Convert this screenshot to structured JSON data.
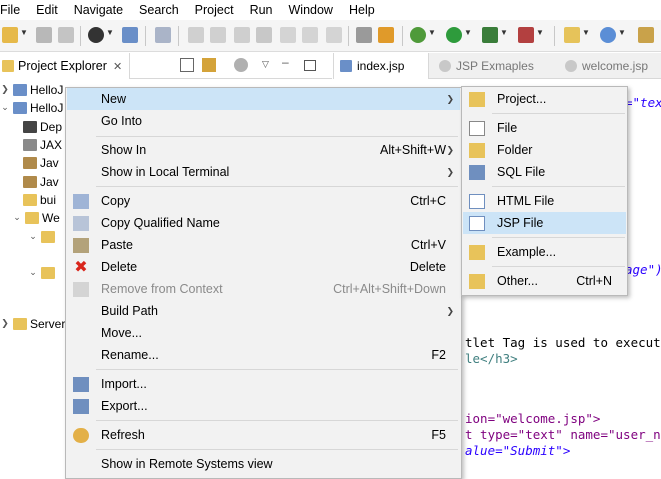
{
  "menubar": {
    "items": [
      "File",
      "Edit",
      "Navigate",
      "Search",
      "Project",
      "Run",
      "Window",
      "Help"
    ]
  },
  "project_explorer": {
    "tab_label": "Project Explorer",
    "close_glyph": "✕",
    "tree": [
      {
        "label": "HelloJ",
        "expanded": false
      },
      {
        "label": "HelloJ",
        "expanded": true
      },
      {
        "label": "Dep"
      },
      {
        "label": "JAX"
      },
      {
        "label": "Jav"
      },
      {
        "label": "Jav"
      },
      {
        "label": "bui"
      },
      {
        "label": "We"
      },
      {
        "label": "Server"
      }
    ]
  },
  "editor": {
    "tabs": [
      {
        "label": "index.jsp",
        "active": true
      },
      {
        "label": "JSP Exmaples",
        "active": false
      },
      {
        "label": "welcome.jsp",
        "active": false
      }
    ],
    "code_fragments": {
      "line_top_attr": "=\"tex",
      "line_age": "age\")",
      "line_scriptlet": "tlet Tag is used to execute",
      "line_h3": "le</h3>",
      "line_action": "ion=\"welcome.jsp\">",
      "line_input": "t type=\"text\" name=\"user_nam",
      "line_value": "alue=\"Submit\">"
    }
  },
  "context_menu": {
    "items": [
      {
        "label": "New",
        "shortcut": "",
        "submenu": true,
        "highlight": true
      },
      {
        "label": "Go Into",
        "shortcut": ""
      },
      {
        "label": "Show In",
        "shortcut": "Alt+Shift+W",
        "submenu": true
      },
      {
        "label": "Show in Local Terminal",
        "shortcut": "",
        "submenu": true
      },
      {
        "label": "Copy",
        "shortcut": "Ctrl+C"
      },
      {
        "label": "Copy Qualified Name",
        "shortcut": ""
      },
      {
        "label": "Paste",
        "shortcut": "Ctrl+V"
      },
      {
        "label": "Delete",
        "shortcut": "Delete"
      },
      {
        "label": "Remove from Context",
        "shortcut": "Ctrl+Alt+Shift+Down",
        "disabled": true
      },
      {
        "label": "Build Path",
        "shortcut": "",
        "submenu": true
      },
      {
        "label": "Move...",
        "shortcut": ""
      },
      {
        "label": "Rename...",
        "shortcut": "F2"
      },
      {
        "label": "Import...",
        "shortcut": ""
      },
      {
        "label": "Export...",
        "shortcut": ""
      },
      {
        "label": "Refresh",
        "shortcut": "F5"
      },
      {
        "label": "Show in Remote Systems view",
        "shortcut": ""
      }
    ]
  },
  "submenu": {
    "items": [
      {
        "label": "Project...",
        "shortcut": ""
      },
      {
        "label": "File",
        "shortcut": ""
      },
      {
        "label": "Folder",
        "shortcut": ""
      },
      {
        "label": "SQL File",
        "shortcut": ""
      },
      {
        "label": "HTML File",
        "shortcut": ""
      },
      {
        "label": "JSP File",
        "shortcut": "",
        "highlight": true
      },
      {
        "label": "Example...",
        "shortcut": ""
      },
      {
        "label": "Other...",
        "shortcut": "Ctrl+N"
      }
    ]
  },
  "colors": {
    "highlight": "#cce4f7",
    "menu_bg": "#f2f2f2",
    "delete_red": "#d9261c",
    "folder_yellow": "#e8c35a"
  }
}
